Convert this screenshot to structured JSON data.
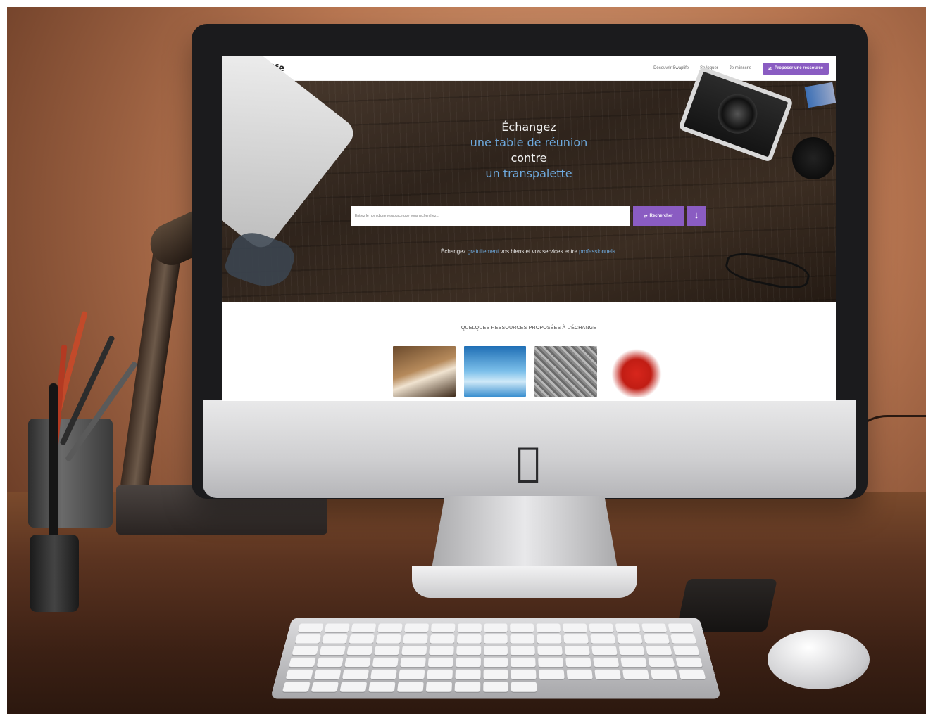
{
  "site": {
    "logo_text": "swaplife"
  },
  "navbar": {
    "links": [
      "Découvrir Swaplife",
      "Se loguer",
      "Je m'inscris"
    ],
    "cta_label": "Proposer une ressource"
  },
  "hero": {
    "headline": {
      "line1": "Échangez",
      "line2": "une table de réunion",
      "line3": "contre",
      "line4": "un transpalette"
    },
    "search": {
      "placeholder": "Entrez le nom d'une ressource que vous recherchez...",
      "button_label": "Rechercher"
    },
    "tagline": {
      "part1": "Échangez ",
      "highlight1": "gratuitement",
      "part2": " vos biens et vos services entre ",
      "highlight2": "professionnels",
      "part3": "."
    }
  },
  "resources": {
    "title": "QUELQUES RESSOURCES PROPOSÉES À L'ÉCHANGE"
  },
  "colors": {
    "accent_purple": "#8a5cc2",
    "highlight_blue": "#6ea9dd"
  },
  "icons": {
    "swap": "swap-icon",
    "download": "download-icon",
    "brand_device": "apple-logo-icon"
  }
}
